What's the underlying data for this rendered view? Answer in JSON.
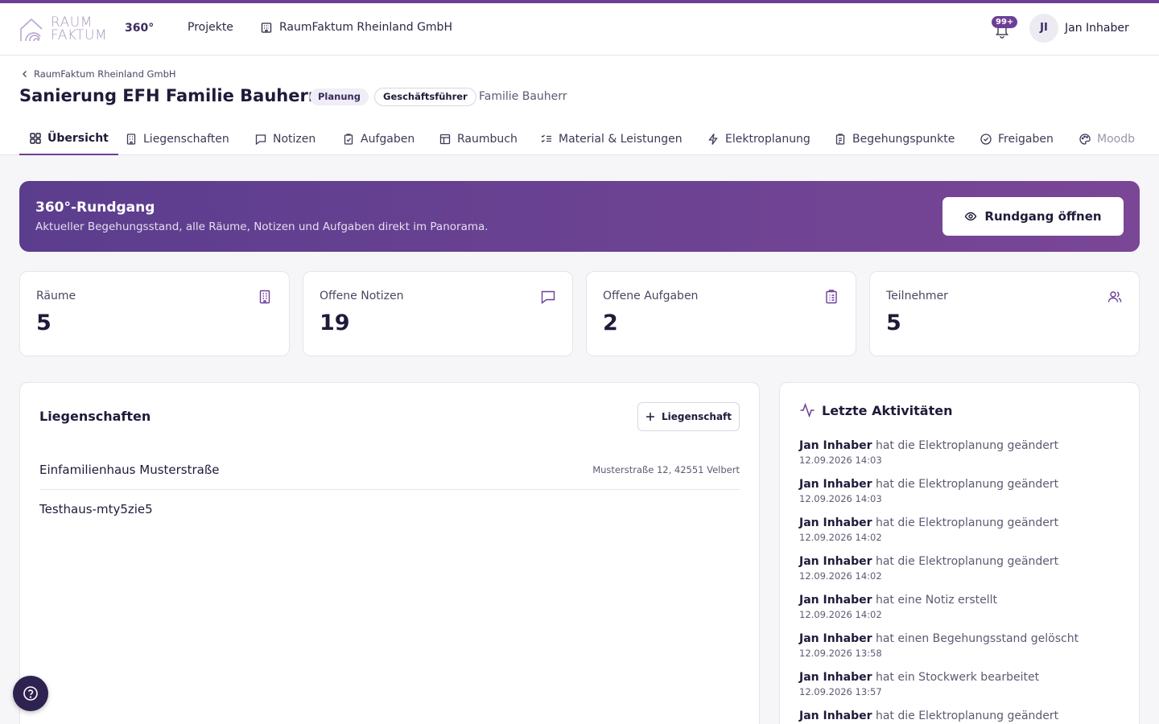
{
  "colors": {
    "accent": "#6b3f96",
    "text_dark": "#1e1b3a",
    "banner_start": "#5b3d8e",
    "banner_end": "#7a4696"
  },
  "header": {
    "logo_line1": "RAUM",
    "logo_line2": "FAKTUM",
    "product": "360°",
    "nav_projects": "Projekte",
    "company": "RaumFaktum Rheinland GmbH",
    "notifications_badge": "99+",
    "avatar_initials": "JI",
    "user_name": "Jan Inhaber"
  },
  "project": {
    "breadcrumb": "RaumFaktum Rheinland GmbH",
    "title": "Sanierung EFH Familie Bauherr",
    "phase": "Planung",
    "role": "Geschäftsführer",
    "client": "Familie Bauherr"
  },
  "tabs": [
    {
      "label": "Übersicht",
      "icon": "grid-icon"
    },
    {
      "label": "Liegenschaften",
      "icon": "building-icon"
    },
    {
      "label": "Notizen",
      "icon": "message-icon"
    },
    {
      "label": "Aufgaben",
      "icon": "clipboard-check-icon"
    },
    {
      "label": "Raumbuch",
      "icon": "table-icon"
    },
    {
      "label": "Material & Leistungen",
      "icon": "list-checks-icon"
    },
    {
      "label": "Elektroplanung",
      "icon": "zap-icon"
    },
    {
      "label": "Begehungspunkte",
      "icon": "clipboard-list-icon"
    },
    {
      "label": "Freigaben",
      "icon": "check-circle-icon"
    },
    {
      "label": "Moodb",
      "icon": "palette-icon"
    }
  ],
  "tour": {
    "title": "360°-Rundgang",
    "subtitle": "Aktueller Begehungsstand, alle Räume, Notizen und Aufgaben direkt im Panorama.",
    "button": "Rundgang öffnen"
  },
  "stats": [
    {
      "label": "Räume",
      "value": "5",
      "icon": "building-icon"
    },
    {
      "label": "Offene Notizen",
      "value": "19",
      "icon": "message-icon"
    },
    {
      "label": "Offene Aufgaben",
      "value": "2",
      "icon": "clipboard-list-icon"
    },
    {
      "label": "Teilnehmer",
      "value": "5",
      "icon": "users-icon"
    }
  ],
  "properties": {
    "title": "Liegenschaften",
    "add_button": "Liegenschaft",
    "items": [
      {
        "name": "Einfamilienhaus Musterstraße",
        "address": "Musterstraße 12, 42551 Velbert"
      },
      {
        "name": "Testhaus-mty5zie5",
        "address": ""
      }
    ]
  },
  "activities": {
    "title": "Letzte Aktivitäten",
    "items": [
      {
        "user": "Jan Inhaber",
        "action": "hat die Elektroplanung geändert",
        "time": "12.09.2026 14:03"
      },
      {
        "user": "Jan Inhaber",
        "action": "hat die Elektroplanung geändert",
        "time": "12.09.2026 14:03"
      },
      {
        "user": "Jan Inhaber",
        "action": "hat die Elektroplanung geändert",
        "time": "12.09.2026 14:02"
      },
      {
        "user": "Jan Inhaber",
        "action": "hat die Elektroplanung geändert",
        "time": "12.09.2026 14:02"
      },
      {
        "user": "Jan Inhaber",
        "action": "hat eine Notiz erstellt",
        "time": "12.09.2026 14:02"
      },
      {
        "user": "Jan Inhaber",
        "action": "hat einen Begehungsstand gelöscht",
        "time": "12.09.2026 13:58"
      },
      {
        "user": "Jan Inhaber",
        "action": "hat ein Stockwerk bearbeitet",
        "time": "12.09.2026 13:57"
      },
      {
        "user": "Jan Inhaber",
        "action": "hat die Elektroplanung geändert",
        "time": ""
      }
    ]
  }
}
